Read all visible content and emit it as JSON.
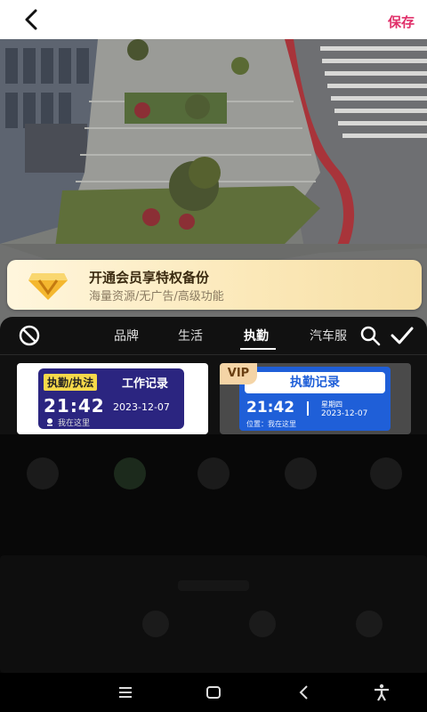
{
  "header": {
    "save_label": "保存"
  },
  "promo": {
    "title": "开通会员享特权备份",
    "subtitle": "海量资源/无广告/高级功能"
  },
  "tabs": [
    {
      "label": "品牌",
      "active": false
    },
    {
      "label": "生活",
      "active": false
    },
    {
      "label": "执勤",
      "active": true
    },
    {
      "label": "汽车服",
      "active": false
    }
  ],
  "stickers": [
    {
      "badge": "执勤/执法",
      "label": "工作记录",
      "time": "21:42",
      "date": "2023-12-07",
      "location": "我在这里"
    },
    {
      "vip": "VIP",
      "title": "执勤记录",
      "time": "21:42",
      "weekday": "星期四",
      "date": "2023-12-07",
      "location": "位置：我在这里"
    }
  ],
  "colors": {
    "save": "#e0306a",
    "card1_bg": "#2b2580",
    "card2_bg": "#1f5fd8",
    "badge": "#f6d94a",
    "vip": "#f4d4a6"
  }
}
